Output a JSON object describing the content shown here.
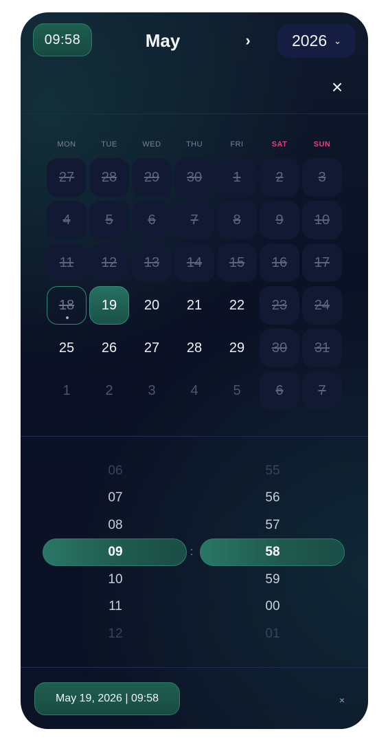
{
  "header": {
    "time": "09:58",
    "month": "May",
    "next": "›",
    "year": "2026",
    "year_chevron": "⌄",
    "close": "×"
  },
  "weekdays": [
    "MON",
    "TUE",
    "WED",
    "THU",
    "FRI",
    "SAT",
    "SUN"
  ],
  "days": [
    {
      "label": "27",
      "state": "disabled"
    },
    {
      "label": "28",
      "state": "disabled"
    },
    {
      "label": "29",
      "state": "disabled"
    },
    {
      "label": "30",
      "state": "disabled"
    },
    {
      "label": "1",
      "state": "disabled"
    },
    {
      "label": "2",
      "state": "disabled"
    },
    {
      "label": "3",
      "state": "disabled"
    },
    {
      "label": "4",
      "state": "disabled"
    },
    {
      "label": "5",
      "state": "disabled"
    },
    {
      "label": "6",
      "state": "disabled"
    },
    {
      "label": "7",
      "state": "disabled"
    },
    {
      "label": "8",
      "state": "disabled"
    },
    {
      "label": "9",
      "state": "disabled"
    },
    {
      "label": "10",
      "state": "disabled"
    },
    {
      "label": "11",
      "state": "disabled"
    },
    {
      "label": "12",
      "state": "disabled"
    },
    {
      "label": "13",
      "state": "disabled"
    },
    {
      "label": "14",
      "state": "disabled"
    },
    {
      "label": "15",
      "state": "disabled"
    },
    {
      "label": "16",
      "state": "disabled"
    },
    {
      "label": "17",
      "state": "disabled"
    },
    {
      "label": "18",
      "state": "today"
    },
    {
      "label": "19",
      "state": "selected"
    },
    {
      "label": "20",
      "state": "normal"
    },
    {
      "label": "21",
      "state": "normal"
    },
    {
      "label": "22",
      "state": "normal"
    },
    {
      "label": "23",
      "state": "disabled"
    },
    {
      "label": "24",
      "state": "disabled"
    },
    {
      "label": "25",
      "state": "normal"
    },
    {
      "label": "26",
      "state": "normal"
    },
    {
      "label": "27",
      "state": "normal"
    },
    {
      "label": "28",
      "state": "normal"
    },
    {
      "label": "29",
      "state": "normal"
    },
    {
      "label": "30",
      "state": "disabled"
    },
    {
      "label": "31",
      "state": "disabled"
    },
    {
      "label": "1",
      "state": "other"
    },
    {
      "label": "2",
      "state": "other"
    },
    {
      "label": "3",
      "state": "other"
    },
    {
      "label": "4",
      "state": "other"
    },
    {
      "label": "5",
      "state": "other"
    },
    {
      "label": "6",
      "state": "disabled"
    },
    {
      "label": "7",
      "state": "disabled"
    }
  ],
  "time_wheel": {
    "hours": [
      "06",
      "07",
      "08",
      "09",
      "10",
      "11",
      "12"
    ],
    "minutes": [
      "55",
      "56",
      "57",
      "58",
      "59",
      "00",
      "01"
    ],
    "selected_index": 3,
    "separator": ":"
  },
  "footer": {
    "summary": "May 19, 2026 | 09:58",
    "clear": "×"
  },
  "colors": {
    "accent": "#246a5b",
    "weekend": "#e0407e",
    "background": "#0b1024"
  }
}
